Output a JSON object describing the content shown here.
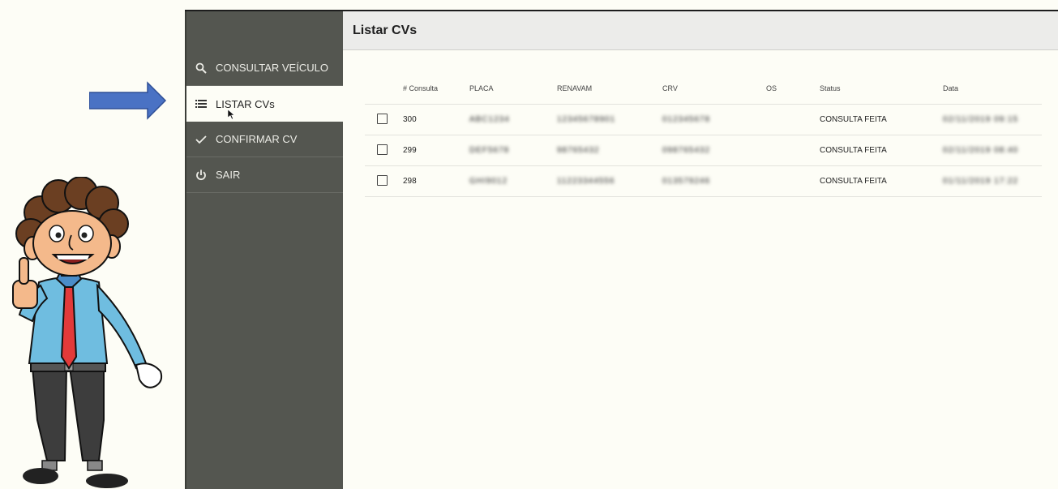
{
  "header": {
    "title": "Listar CVs"
  },
  "sidebar": {
    "items": [
      {
        "label": "CONSULTAR VEÍCULO",
        "icon": "search-icon"
      },
      {
        "label": "LISTAR CVs",
        "icon": "list-icon"
      },
      {
        "label": "CONFIRMAR CV",
        "icon": "check-icon"
      },
      {
        "label": "SAIR",
        "icon": "power-icon"
      }
    ]
  },
  "table": {
    "columns": [
      "# Consulta",
      "PLACA",
      "RENAVAM",
      "CRV",
      "OS",
      "Status",
      "Data"
    ],
    "rows": [
      {
        "consulta": "300",
        "placa": "ABC1234",
        "renavam": "12345678901",
        "crv": "012345678",
        "os": "",
        "status": "CONSULTA FEITA",
        "data": "02/11/2019 09:15"
      },
      {
        "consulta": "299",
        "placa": "DEF5678",
        "renavam": "98765432",
        "crv": "098765432",
        "os": "",
        "status": "CONSULTA FEITA",
        "data": "02/11/2019 08:40"
      },
      {
        "consulta": "298",
        "placa": "GHI9012",
        "renavam": "11223344556",
        "crv": "013579246",
        "os": "",
        "status": "CONSULTA FEITA",
        "data": "01/11/2019 17:22"
      }
    ]
  },
  "colors": {
    "sidebar": "#545650",
    "header": "#ececea",
    "arrow": "#4a72c4"
  }
}
